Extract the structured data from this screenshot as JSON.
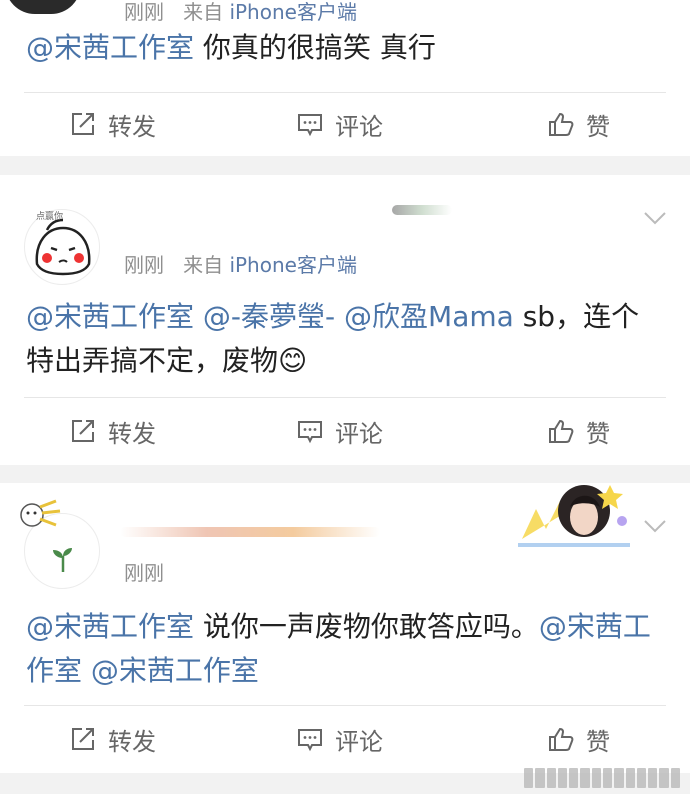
{
  "comments": [
    {
      "meta": {
        "time": "刚刚",
        "from": "来自",
        "source": "iPhone客户端"
      },
      "content": {
        "mention1": "@宋茜工作室",
        "text": " 你真的很搞笑 真行"
      },
      "actions": {
        "forward": "转发",
        "comment": "评论",
        "like": "赞"
      }
    },
    {
      "avatar_label": "点赢你",
      "meta": {
        "time": "刚刚",
        "from": "来自",
        "source": "iPhone客户端"
      },
      "content": {
        "mention1": "@宋茜工作室",
        "mention2": "@-秦夢瑩-",
        "mention3": "@欣盈Mama",
        "text": " sb，连个特出弄搞不定，废物😊"
      },
      "actions": {
        "forward": "转发",
        "comment": "评论",
        "like": "赞"
      }
    },
    {
      "meta": {
        "time": "刚刚"
      },
      "content": {
        "mention1": "@宋茜工作室",
        "text": " 说你一声废物你敢答应吗。",
        "mention2": "@宋茜工作室",
        "mention3": "@宋茜工作室"
      },
      "actions": {
        "forward": "转发",
        "comment": "评论",
        "like": "赞"
      }
    }
  ],
  "colors": {
    "mention": "#4a74a8",
    "source": "#5b7aa8",
    "meta": "#8f8f8f",
    "action": "#666666",
    "background": "#f2f2f2"
  }
}
